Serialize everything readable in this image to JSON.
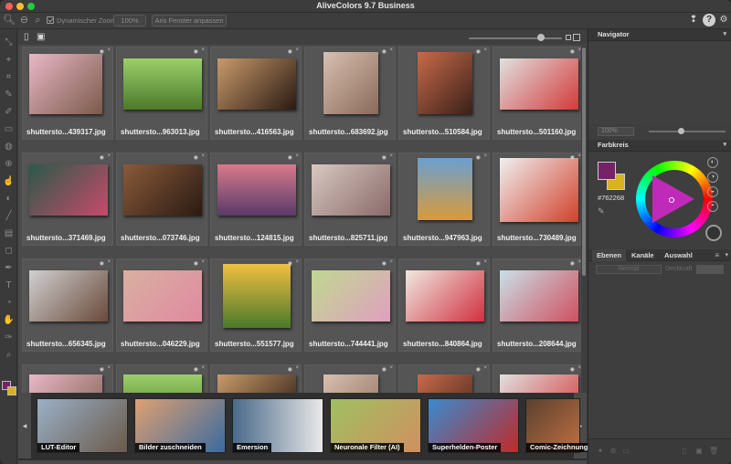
{
  "window": {
    "title": "AliveColors 9.7 Business"
  },
  "toolbar": {
    "dynamic_zoom_label": "Dynamischer Zoom",
    "zoom_value": "100%",
    "fit_window_label": "Ans Fenster anpassen"
  },
  "browser": {
    "files": [
      {
        "name": "shuttersto...439317.jpg"
      },
      {
        "name": "shuttersto...963013.jpg"
      },
      {
        "name": "shuttersto...416563.jpg"
      },
      {
        "name": "shuttersto...683692.jpg"
      },
      {
        "name": "shuttersto...510584.jpg"
      },
      {
        "name": "shuttersto...501160.jpg"
      },
      {
        "name": "shuttersto...371469.jpg"
      },
      {
        "name": "shuttersto...073746.jpg"
      },
      {
        "name": "shuttersto...124815.jpg"
      },
      {
        "name": "shuttersto...825711.jpg"
      },
      {
        "name": "shuttersto...947963.jpg"
      },
      {
        "name": "shuttersto...730489.jpg"
      },
      {
        "name": "shuttersto...656345.jpg"
      },
      {
        "name": "shuttersto...046229.jpg"
      },
      {
        "name": "shuttersto...551577.jpg"
      },
      {
        "name": "shuttersto...744441.jpg"
      },
      {
        "name": "shuttersto...840864.jpg"
      },
      {
        "name": "shuttersto...208644.jpg"
      }
    ]
  },
  "filmstrip": {
    "presets": [
      {
        "label": "LUT-Editor"
      },
      {
        "label": "Bilder zuschneiden"
      },
      {
        "label": "Emersion"
      },
      {
        "label": "Neuronale Filter (AI)"
      },
      {
        "label": "Superhelden-Poster"
      },
      {
        "label": "Comic-Zeichnung"
      }
    ]
  },
  "panel": {
    "navigator_title": "Navigator",
    "zoom_value": "100%",
    "colorwheel_title": "Farbkreis",
    "hex": "#762268",
    "tabs": [
      "Ebenen",
      "Kanäle",
      "Auswahl"
    ],
    "blend_mode": "Normal",
    "opacity_label": "Deckkraft"
  },
  "colors": {
    "foreground": "#762268",
    "background": "#d8b21f"
  }
}
